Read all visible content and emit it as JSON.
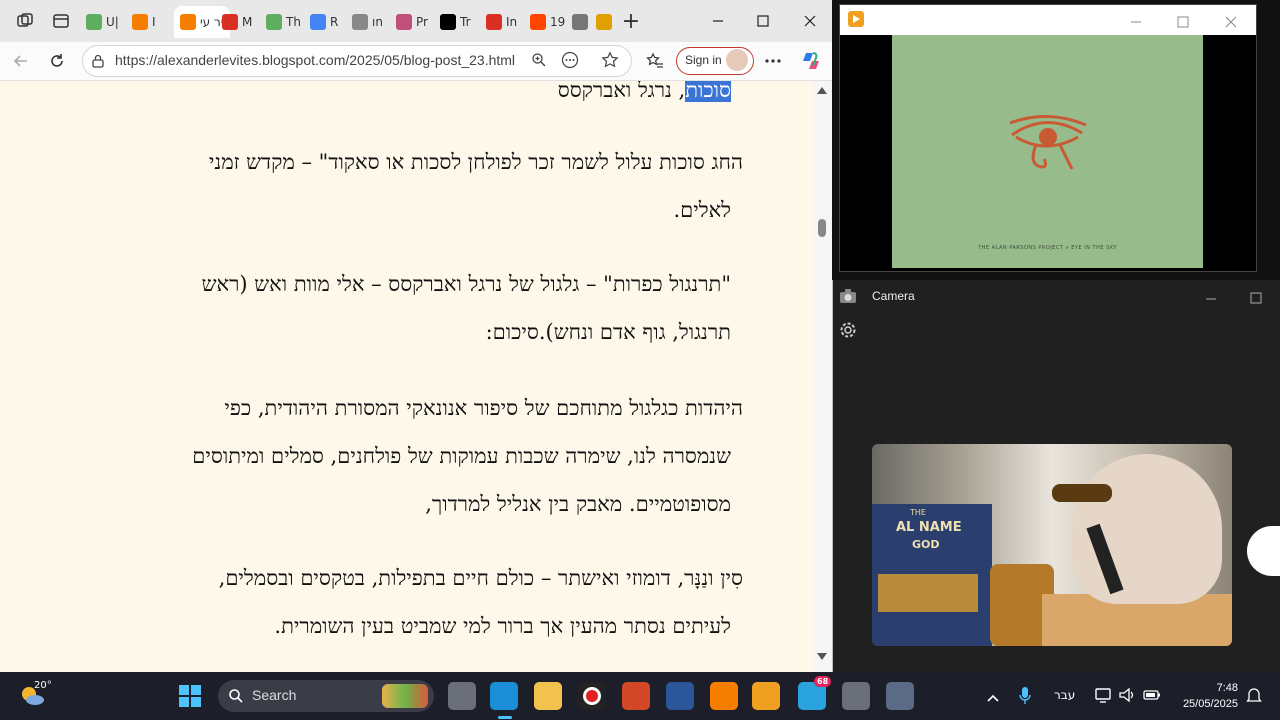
{
  "browser": {
    "tabs": [
      {
        "label": "U|",
        "icon": "play-icon",
        "color": "#5fae5f"
      },
      {
        "label": "I",
        "icon": "blogger-icon",
        "color": "#f57d00"
      },
      {
        "label": "יר עי",
        "icon": "blogger-icon",
        "color": "#f57d00",
        "active": true
      },
      {
        "label": "M",
        "icon": "gmail-icon",
        "color": "#d93025"
      },
      {
        "label": "Th",
        "icon": "play-icon",
        "color": "#5fae5f"
      },
      {
        "label": "R",
        "icon": "google-icon",
        "color": "#4285f4"
      },
      {
        "label": "ın",
        "icon": "settings-icon",
        "color": "#888888"
      },
      {
        "label": "Pr",
        "icon": "k-icon",
        "color": "#c0507a"
      },
      {
        "label": "Tr",
        "icon": "x-icon",
        "color": "#000000"
      },
      {
        "label": "In",
        "icon": "gmail-icon",
        "color": "#d93025"
      },
      {
        "label": "19",
        "icon": "reddit-icon",
        "color": "#ff4500"
      },
      {
        "label": "",
        "icon": "x-icon",
        "color": "#777777"
      },
      {
        "label": "",
        "icon": "sun-icon",
        "color": "#e0a000"
      }
    ],
    "new_tab": "+",
    "url": "https://alexanderlevites.blogspot.com/2025/05/blog-post_23.html",
    "sign_in": "Sign in"
  },
  "article": {
    "top_line_plain": ", נרגל ואברקסס",
    "top_line_highlight": "סוכות",
    "p1_line1": "החג סוכות עלול לשמר זכר לפולחן לסכות או סאקוד\" – מקדש זמני",
    "p1_line2": "לאלים.",
    "p2_line1": "\"תרנגול כפרות\" – גלגול של נרגל ואברקסס – אלי מוות ואש (ראש",
    "p2_line2": "תרנגול, גוף אדם ונחש).סיכום:",
    "p3_line1": "היהדות כגלגול מתוחכם של סיפור אנונאקי המסורת היהודית, כפי",
    "p3_line2": "שנמסרה לנו, שימרה שכבות עמוקות של פולחנים, סמלים ומיתוסים",
    "p3_line3": "מסופוטמיים. מאבק בין אנליל למרדוך,",
    "p4_line1": "סִין ונַנָּר, דומוזי ואישתר – כולם חיים בתפילות, בטקסים ובסמלים,",
    "p4_line2": "לעיתים נסתר מהעין אך ברור למי שמביט בעין השומרית."
  },
  "video_window": {
    "album_caption": "THE ALAN PARSONS PROJECT ⅇ EYE IN THE SKY",
    "album_color": "#98bb8c",
    "eye_color": "#c85a34"
  },
  "camera_window": {
    "title": "Camera",
    "book_text_1": "THE",
    "book_text_2": "AL NAME",
    "book_text_3": "GOD"
  },
  "taskbar": {
    "weather": "20°",
    "search_placeholder": "Search",
    "language": "עבר",
    "time": "7:48",
    "date": "25/05/2025",
    "telegram_badge": "68"
  }
}
